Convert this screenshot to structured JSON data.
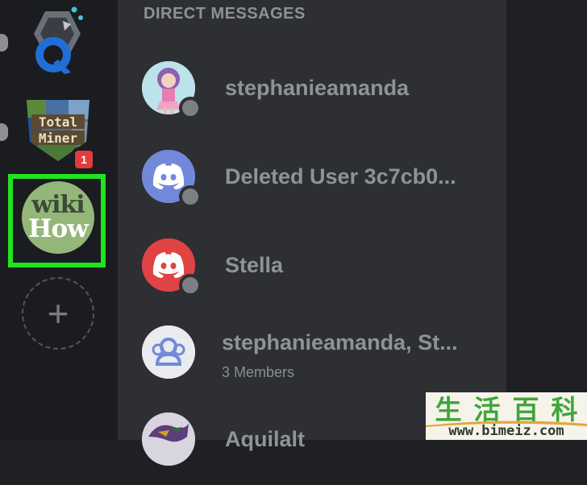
{
  "servers": {
    "quick": {
      "name": "Q server"
    },
    "total_miner": {
      "name": "Total Miner",
      "badge": "1"
    },
    "wikihow": {
      "line1": "wiki",
      "line2": "How"
    },
    "add": {
      "symbol": "+"
    }
  },
  "dm": {
    "header": "DIRECT MESSAGES",
    "items": [
      {
        "name": "stephanieamanda",
        "avatar": "doll-photo",
        "status": "offline"
      },
      {
        "name": "Deleted User 3c7cb0...",
        "avatar": "discord-blurple",
        "status": "offline"
      },
      {
        "name": "Stella",
        "avatar": "discord-red",
        "status": "offline"
      },
      {
        "name": "stephanieamanda, St...",
        "sub": "3 Members",
        "avatar": "group-icon"
      },
      {
        "name": "Aquilalt",
        "avatar": "dragon-photo"
      }
    ]
  },
  "watermark": {
    "chars": [
      "生",
      "活",
      "百",
      "科"
    ],
    "url": "www.bimeiz.com"
  },
  "colors": {
    "highlight": "#20e41f",
    "blurple": "#7289da",
    "red": "#f04747",
    "badge": "#e03c3c"
  }
}
